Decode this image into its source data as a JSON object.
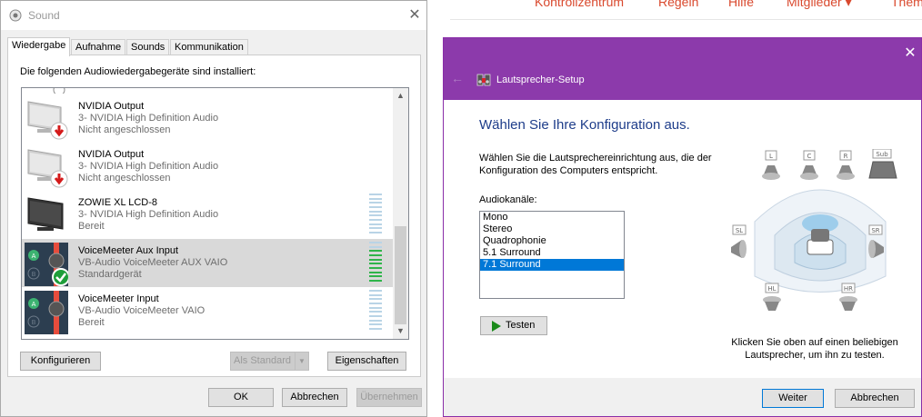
{
  "website": {
    "nav_items": [
      "Kontrollzentrum",
      "Regeln",
      "Hilfe",
      "Mitglieder ▾",
      "Them"
    ]
  },
  "sound_dialog": {
    "title": "Sound",
    "tabs": [
      "Wiedergabe",
      "Aufnahme",
      "Sounds",
      "Kommunikation"
    ],
    "heading": "Die folgenden Audiowiedergabegeräte sind installiert:",
    "devices": [
      {
        "name": "NVIDIA Output",
        "driver": "3- NVIDIA High Definition Audio",
        "status": "Nicht angeschlossen",
        "icon": "monitor-icon"
      },
      {
        "name": "NVIDIA Output",
        "driver": "3- NVIDIA High Definition Audio",
        "status": "Nicht angeschlossen",
        "icon": "monitor-icon"
      },
      {
        "name": "ZOWIE XL LCD-8",
        "driver": "3- NVIDIA High Definition Audio",
        "status": "Bereit",
        "icon": "monitor-icon"
      },
      {
        "name": "VoiceMeeter Aux Input",
        "driver": "VB-Audio VoiceMeeter AUX VAIO",
        "status": "Standardgerät",
        "icon": "voicemeeter-icon"
      },
      {
        "name": "VoiceMeeter Input",
        "driver": "VB-Audio VoiceMeeter VAIO",
        "status": "Bereit",
        "icon": "voicemeeter-icon"
      }
    ],
    "buttons": {
      "configure": "Konfigurieren",
      "set_default": "Als Standard",
      "properties": "Eigenschaften",
      "ok": "OK",
      "cancel": "Abbrechen",
      "apply": "Übernehmen"
    }
  },
  "speaker_setup": {
    "title": "Lautsprecher-Setup",
    "heading": "Wählen Sie Ihre Konfiguration aus.",
    "description": "Wählen Sie die Lautsprechereinrichtung aus, die der Konfiguration des Computers entspricht.",
    "channels_label": "Audiokanäle:",
    "channels": [
      "Mono",
      "Stereo",
      "Quadrophonie",
      "5.1 Surround",
      "7.1 Surround"
    ],
    "selected_channel": "7.1 Surround",
    "test_button": "Testen",
    "speaker_labels": [
      "L",
      "C",
      "R",
      "Sub",
      "SL",
      "SR",
      "HL",
      "HR"
    ],
    "hint": "Klicken Sie oben auf einen beliebigen Lautsprecher, um ihn zu testen.",
    "buttons": {
      "next": "Weiter",
      "cancel": "Abbrechen"
    }
  },
  "colors": {
    "header_purple": "#8c3aab",
    "heading_blue": "#1e3d8a",
    "selection_blue": "#0078d7",
    "meter_green": "#2fb44a",
    "nav_orange": "#d9492e"
  }
}
